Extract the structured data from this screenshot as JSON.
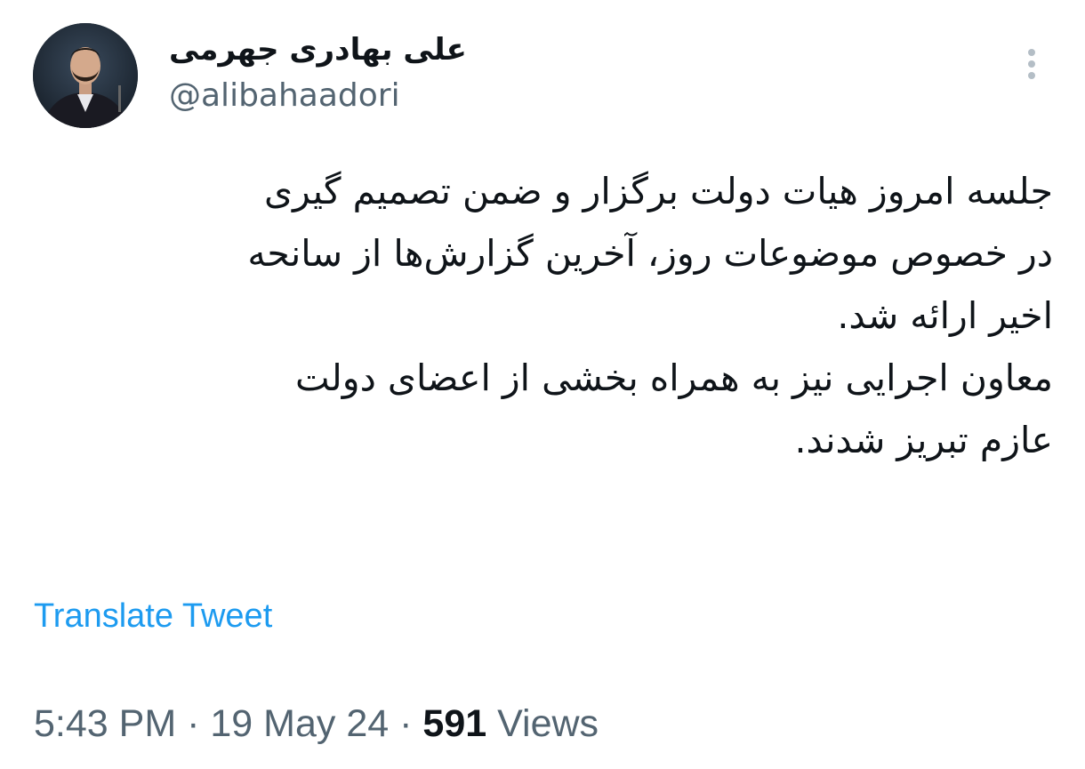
{
  "author": {
    "display_name": "علی بهادری جهرمی",
    "handle": "@alibahaadori"
  },
  "tweet": {
    "lines": [
      "جلسه امروز هیات دولت برگزار و ضمن تصمیم گیری",
      "در خصوص موضوعات روز، آخرین گزارش‌ها از سانحه",
      "اخیر ارائه شد.",
      "معاون اجرایی نیز به همراه بخشی از اعضای دولت",
      "عازم تبریز شدند."
    ]
  },
  "translate_label": "Translate Tweet",
  "meta": {
    "time": "5:43 PM",
    "separator": "·",
    "date": "19 May 24",
    "views_count": "591",
    "views_label": "Views"
  },
  "colors": {
    "link": "#1d9bf0",
    "secondary_text": "#536471",
    "primary_text": "#0f1419"
  },
  "icons": {
    "more": "vertical-ellipsis-icon"
  }
}
